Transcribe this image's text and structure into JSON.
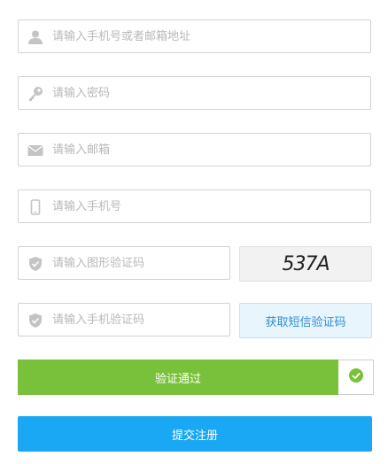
{
  "form": {
    "account": {
      "placeholder": "请输入手机号或者邮箱地址",
      "icon": "user-icon"
    },
    "password": {
      "placeholder": "请输入密码",
      "icon": "key-icon"
    },
    "email": {
      "placeholder": "请输入邮箱",
      "icon": "envelope-icon"
    },
    "phone": {
      "placeholder": "请输入手机号",
      "icon": "mobile-phone-icon"
    },
    "captcha": {
      "placeholder": "请输入图形验证码",
      "icon": "shield-icon",
      "image_text": "537A"
    },
    "sms_code": {
      "placeholder": "请输入手机验证码",
      "icon": "shield-icon",
      "button_label": "获取短信验证码"
    },
    "verify": {
      "label": "验证通过",
      "status_icon": "check-circle-icon",
      "color": "#7ac13b"
    },
    "submit": {
      "label": "提交注册",
      "color": "#1aa7f3"
    }
  }
}
